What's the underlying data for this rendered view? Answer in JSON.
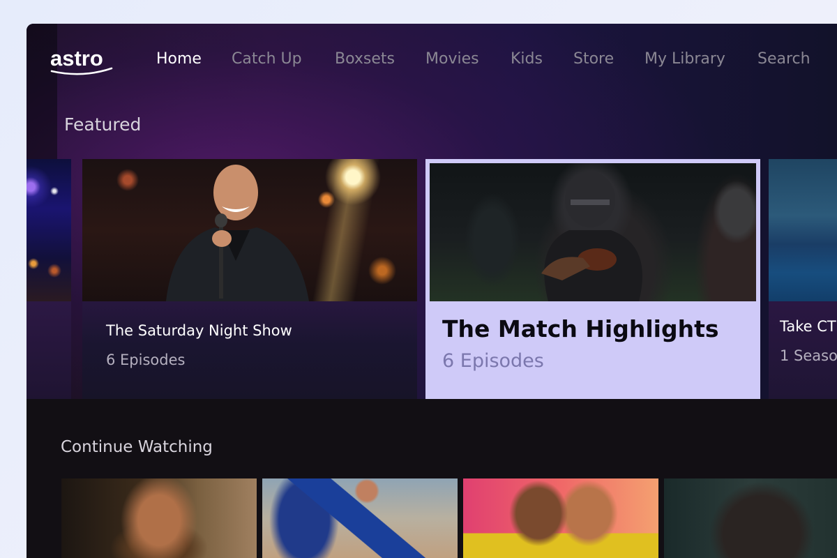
{
  "app": {
    "logo_text": "astro"
  },
  "nav": {
    "items": [
      {
        "label": "Home",
        "active": true
      },
      {
        "label": "Catch Up",
        "active": false
      },
      {
        "label": "Boxsets",
        "active": false
      },
      {
        "label": "Movies",
        "active": false
      },
      {
        "label": "Kids",
        "active": false
      },
      {
        "label": "Store",
        "active": false
      },
      {
        "label": "My Library",
        "active": false
      },
      {
        "label": "Search",
        "active": false
      }
    ]
  },
  "featured": {
    "title": "Featured",
    "cards": [
      {
        "title": "The Saturday Night Show",
        "subtitle": "6 Episodes",
        "focused": false
      },
      {
        "title": "The Match Highlights",
        "subtitle": "6 Episodes",
        "focused": true
      },
      {
        "title": "Take CT",
        "subtitle": "1 Seaso",
        "focused": false
      }
    ]
  },
  "continue_watching": {
    "title": "Continue Watching"
  },
  "colors": {
    "background": "#120f14",
    "focus_card": "#cfcaf8",
    "focus_subtitle": "#7b77ad",
    "nav_inactive": "#8b8894"
  }
}
